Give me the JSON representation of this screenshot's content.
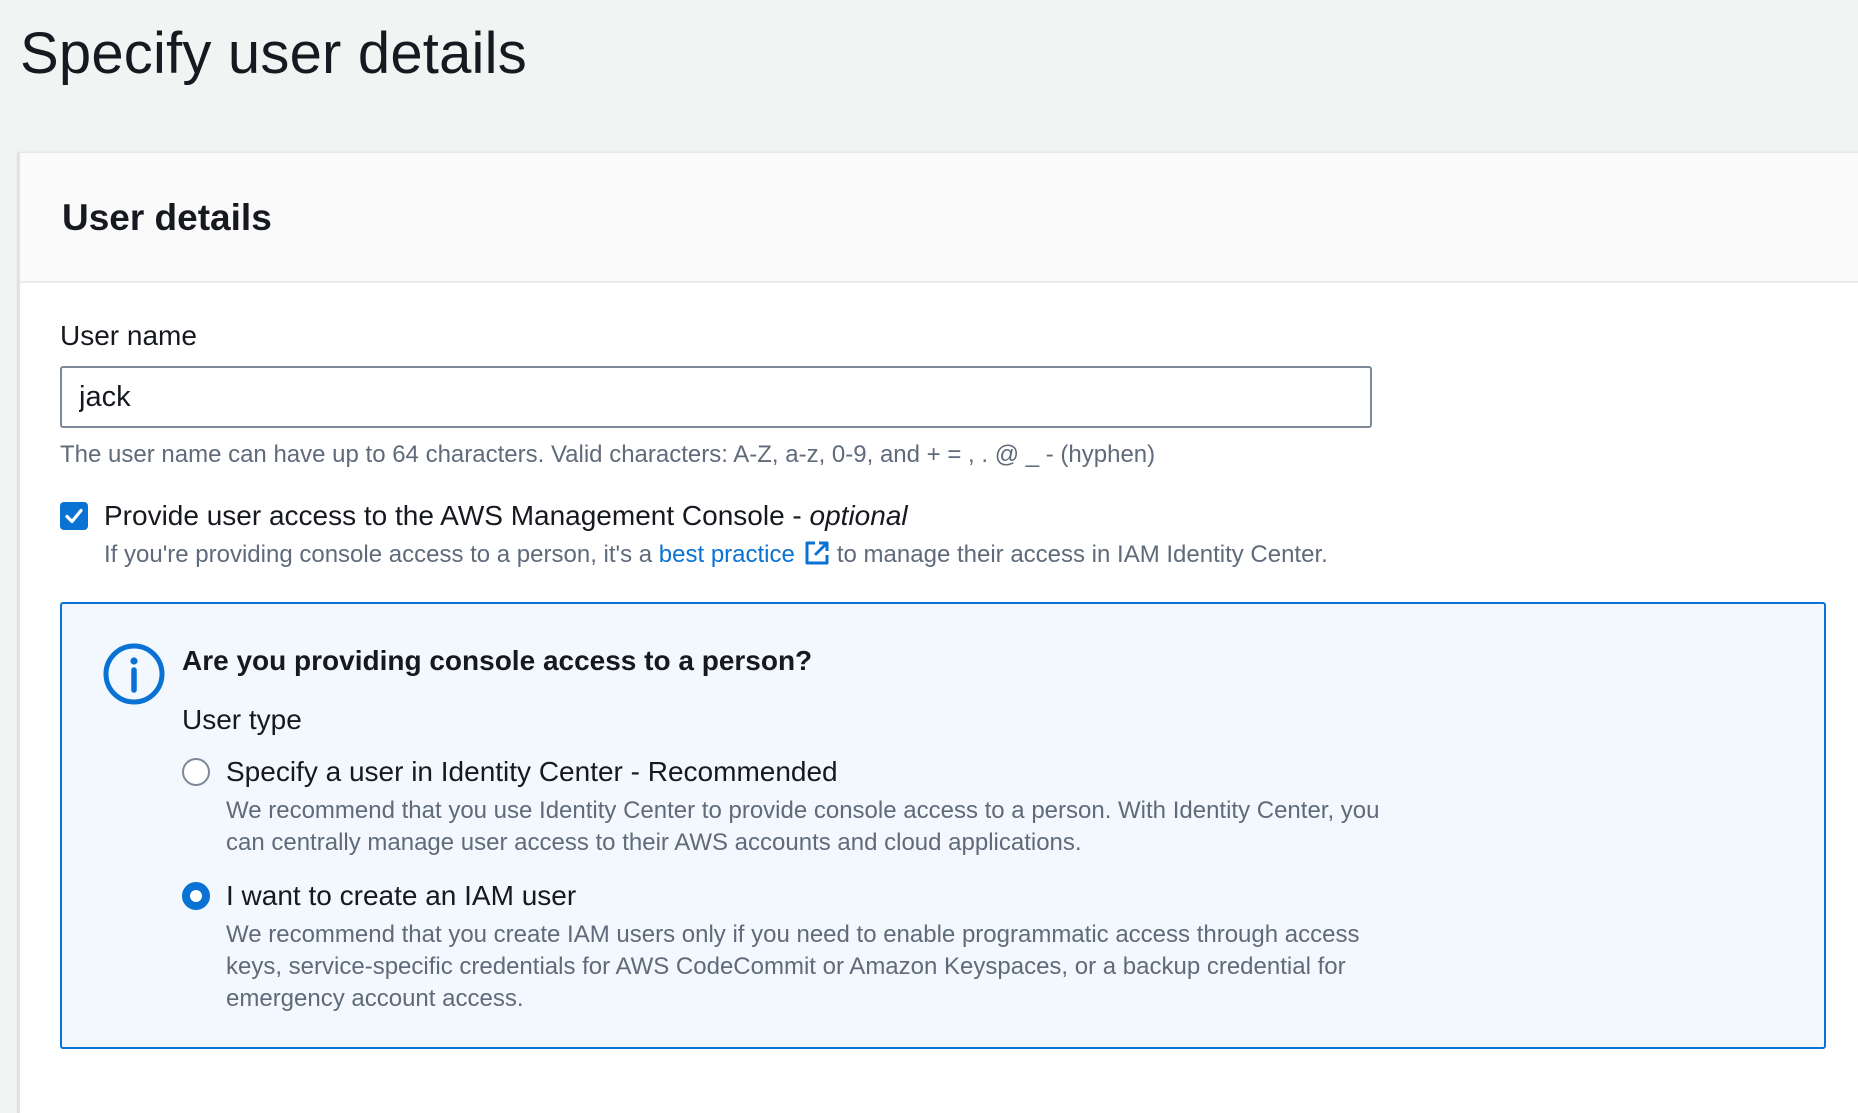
{
  "page": {
    "title": "Specify user details"
  },
  "panel": {
    "title": "User details"
  },
  "user_name": {
    "label": "User name",
    "value": "jack",
    "hint": "The user name can have up to 64 characters. Valid characters: A-Z, a-z, 0-9, and + = , . @ _ - (hyphen)"
  },
  "console_access": {
    "checked": true,
    "label": "Provide user access to the AWS Management Console - ",
    "optional": "optional",
    "desc_before": "If you're providing console access to a person, it's a ",
    "link_text": "best practice",
    "desc_after": "to manage their access in IAM Identity Center."
  },
  "alert": {
    "title": "Are you providing console access to a person?",
    "user_type_label": "User type",
    "options": [
      {
        "label": "Specify a user in Identity Center - Recommended",
        "description": "We recommend that you use Identity Center to provide console access to a person. With Identity Center, you can centrally manage user access to their AWS accounts and cloud applications.",
        "selected": false
      },
      {
        "label": "I want to create an IAM user",
        "description": "We recommend that you create IAM users only if you need to enable programmatic access through access keys, service-specific credentials for AWS CodeCommit or Amazon Keyspaces, or a backup credential for emergency account access.",
        "selected": true
      }
    ]
  },
  "colors": {
    "accent": "#0972d3",
    "text": "#16191f",
    "secondary_text": "#5f6b7a",
    "alert_background": "#f2f8fd"
  },
  "icons": {
    "checkbox": "check-icon",
    "external_link": "external-link-icon",
    "info": "info-icon"
  }
}
